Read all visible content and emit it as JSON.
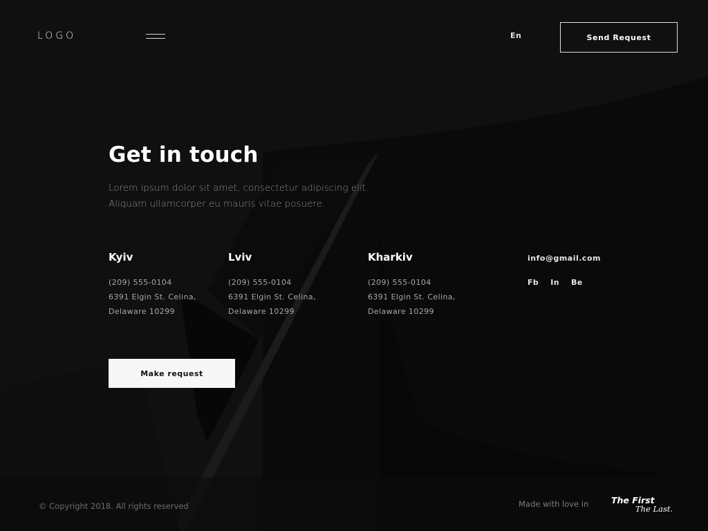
{
  "header": {
    "logo": "LOGO",
    "menu_icon": "hamburger-menu-icon",
    "language": "En",
    "send_request_label": "Send Request"
  },
  "hero": {
    "title": "Get in touch",
    "subtitle_lines": [
      "Lorem ipsum dolor sit amet, consectetur adipiscing elit.",
      "Aliquam ullamcorper eu mauris vitae posuere."
    ]
  },
  "offices": [
    {
      "city": "Kyiv",
      "phone": "(209) 555-0104",
      "street": "6391 Elgin St. Celina,",
      "region": "Delaware 10299"
    },
    {
      "city": "Lviv",
      "phone": "(209) 555-0104",
      "street": "6391 Elgin St. Celina,",
      "region": "Delaware 10299"
    },
    {
      "city": "Kharkiv",
      "phone": "(209) 555-0104",
      "street": "6391 Elgin St. Celina,",
      "region": "Delaware 10299"
    }
  ],
  "contact": {
    "email": "info@gmail.com",
    "social": [
      "Fb",
      "In",
      "Be"
    ]
  },
  "cta": {
    "make_request_label": "Make request"
  },
  "footer": {
    "copyright": "© Copyright 2018. All rights reserved",
    "made_with": "Made with love in",
    "brand_line1": "The First",
    "brand_line2": "The Last."
  },
  "colors": {
    "background": "#0d0d0d",
    "text": "#ffffff",
    "muted_text": "#8a8a8a",
    "button_fill": "#f7f7f7"
  }
}
